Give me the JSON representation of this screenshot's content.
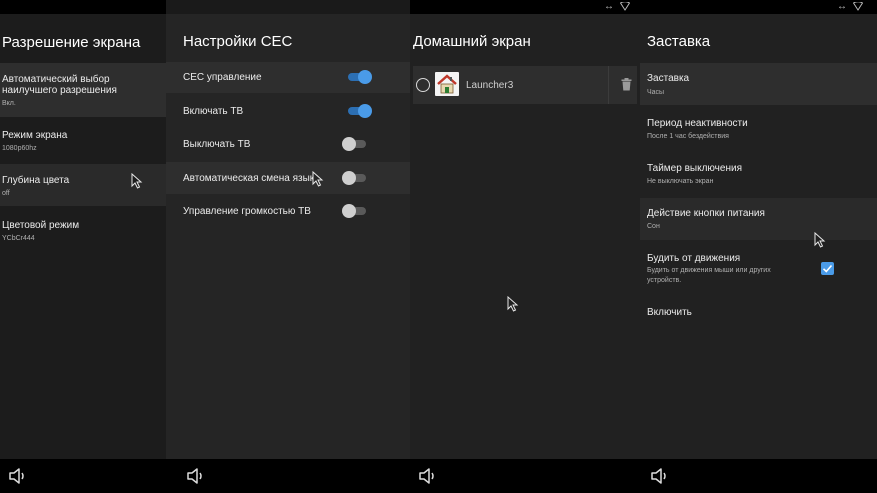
{
  "panels": {
    "resolution": {
      "title": "Разрешение экрана",
      "items": [
        {
          "title_line1": "Автоматический выбор",
          "title_line2": "наилучшего разрешения",
          "subtitle": "Вкл."
        },
        {
          "title": "Режим экрана",
          "subtitle": "1080p60hz"
        },
        {
          "title": "Глубина цвета",
          "subtitle": "off"
        },
        {
          "title": "Цветовой режим",
          "subtitle": "YCbCr444"
        }
      ]
    },
    "cec": {
      "title": "Настройки CEC",
      "items": [
        {
          "title": "CEC управление",
          "state": "on"
        },
        {
          "title": "Включать ТВ",
          "state": "on"
        },
        {
          "title": "Выключать ТВ",
          "state": "off"
        },
        {
          "title": "Автоматическая смена языка",
          "state": "off"
        },
        {
          "title": "Управление громкостью ТВ",
          "state": "off"
        }
      ]
    },
    "home": {
      "title": "Домашний экран",
      "launcher": {
        "name": "Launcher3"
      }
    },
    "screensaver": {
      "title": "Заставка",
      "items": [
        {
          "title": "Заставка",
          "subtitle": "Часы"
        },
        {
          "title": "Период неактивности",
          "subtitle": "После 1 час бездействия"
        },
        {
          "title": "Таймер выключения",
          "subtitle": "Не выключать экран"
        },
        {
          "title": "Действие кнопки питания",
          "subtitle": "Сон"
        },
        {
          "title": "Будить от движения",
          "subtitle_line1": "Будить от движения мыши или других",
          "subtitle_line2": "устройств.",
          "checked": true
        },
        {
          "title": "Включить"
        }
      ]
    }
  },
  "status": {
    "icons": [
      "arrows-icon",
      "wifi-icon"
    ]
  },
  "colors": {
    "accent": "#4a9be8",
    "background": "#212121",
    "selected_row": "#2e2e2e"
  }
}
